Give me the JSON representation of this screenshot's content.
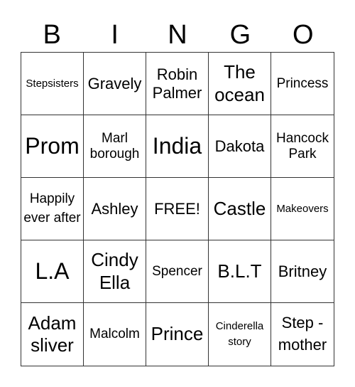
{
  "header": [
    "B",
    "I",
    "N",
    "G",
    "O"
  ],
  "cells": [
    "Stepsisters",
    "Gravely",
    "Robin Palmer",
    "The ocean",
    "Princess",
    "Prom",
    "Marl borough",
    "India",
    "Dakota",
    "Hancock Park",
    "Happily ever after",
    "Ashley",
    "FREE!",
    "Castle",
    "Makeovers",
    "L.A",
    "Cindy Ella",
    "Spencer",
    "B.L.T",
    "Britney",
    "Adam sliver",
    "Malcolm",
    "Prince",
    "Cinderella story",
    "Step - mother"
  ]
}
